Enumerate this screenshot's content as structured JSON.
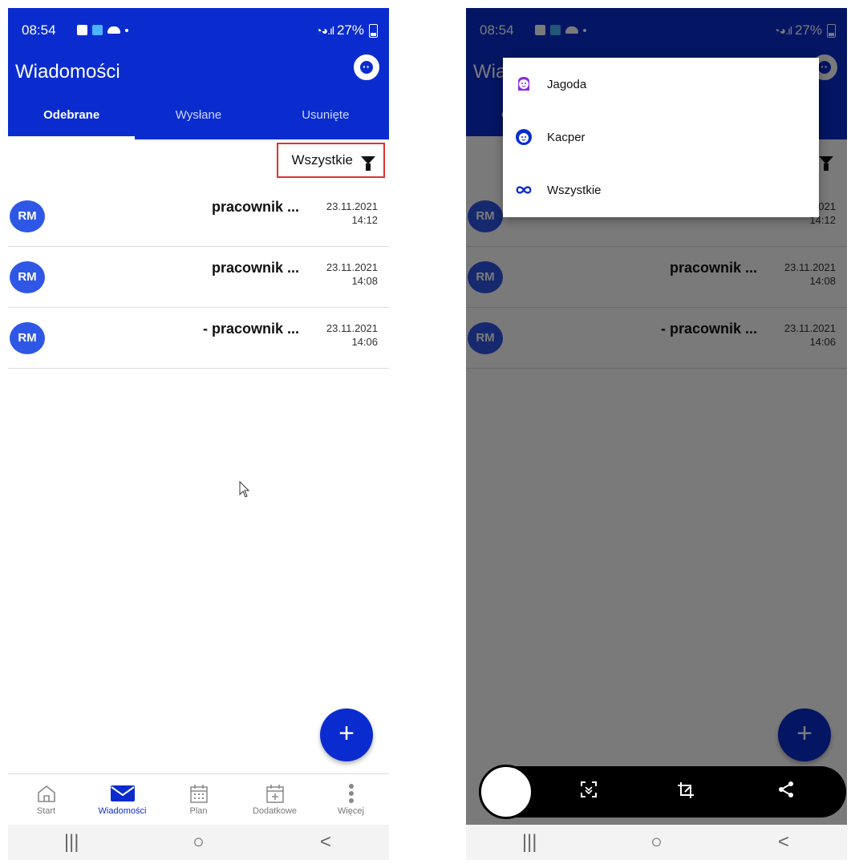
{
  "status_bar": {
    "time": "08:54",
    "battery": "27%"
  },
  "app": {
    "title": "Wiadomości"
  },
  "tabs": [
    {
      "label": "Odebrane",
      "active": true
    },
    {
      "label": "Wysłane",
      "active": false
    },
    {
      "label": "Usunięte",
      "active": false
    }
  ],
  "filter": {
    "label": "Wszystkie"
  },
  "messages": [
    {
      "avatar": "RM",
      "title": "pracownik ...",
      "date": "23.11.2021",
      "time": "14:12"
    },
    {
      "avatar": "RM",
      "title": "pracownik ...",
      "date": "23.11.2021",
      "time": "14:08"
    },
    {
      "avatar": "RM",
      "title": "- pracownik ...",
      "date": "23.11.2021",
      "time": "14:06"
    }
  ],
  "fab": {
    "label": "+"
  },
  "bottom_nav": [
    {
      "label": "Start",
      "icon": "home-icon"
    },
    {
      "label": "Wiadomości",
      "icon": "mail-icon",
      "active": true
    },
    {
      "label": "Plan",
      "icon": "calendar-icon"
    },
    {
      "label": "Dodatkowe",
      "icon": "calendar-add-icon"
    },
    {
      "label": "Więcej",
      "icon": "more-vertical-icon"
    }
  ],
  "system_nav": {
    "recents": "|||",
    "home": "○",
    "back": "<"
  },
  "dropdown": {
    "items": [
      {
        "label": "Jagoda",
        "icon": "girl-avatar-icon"
      },
      {
        "label": "Kacper",
        "icon": "boy-avatar-icon"
      },
      {
        "label": "Wszystkie",
        "icon": "infinity-icon"
      }
    ]
  },
  "colors": {
    "primary": "#0a2ccf",
    "avatar": "#2f57e6",
    "highlight": "#e03030"
  }
}
